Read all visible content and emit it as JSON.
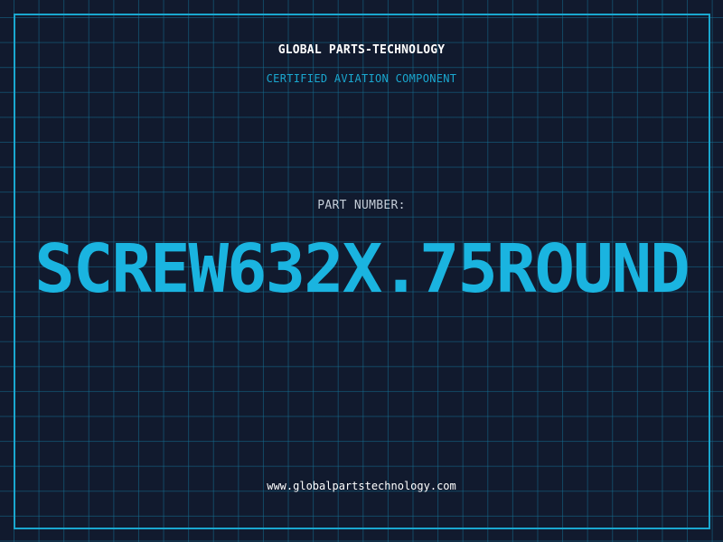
{
  "header": {
    "company": "GLOBAL PARTS-TECHNOLOGY",
    "subtitle": "CERTIFIED AVIATION COMPONENT"
  },
  "main": {
    "part_label": "PART NUMBER:",
    "part_number": "SCREW632X.75ROUND"
  },
  "footer": {
    "website": "www.globalpartstechnology.com"
  },
  "colors": {
    "background": "#111a2e",
    "grid": "#146e91",
    "accent": "#1aa7cf",
    "part_number": "#1ab4e0",
    "text": "#ffffff",
    "label": "#c4cdd8"
  }
}
